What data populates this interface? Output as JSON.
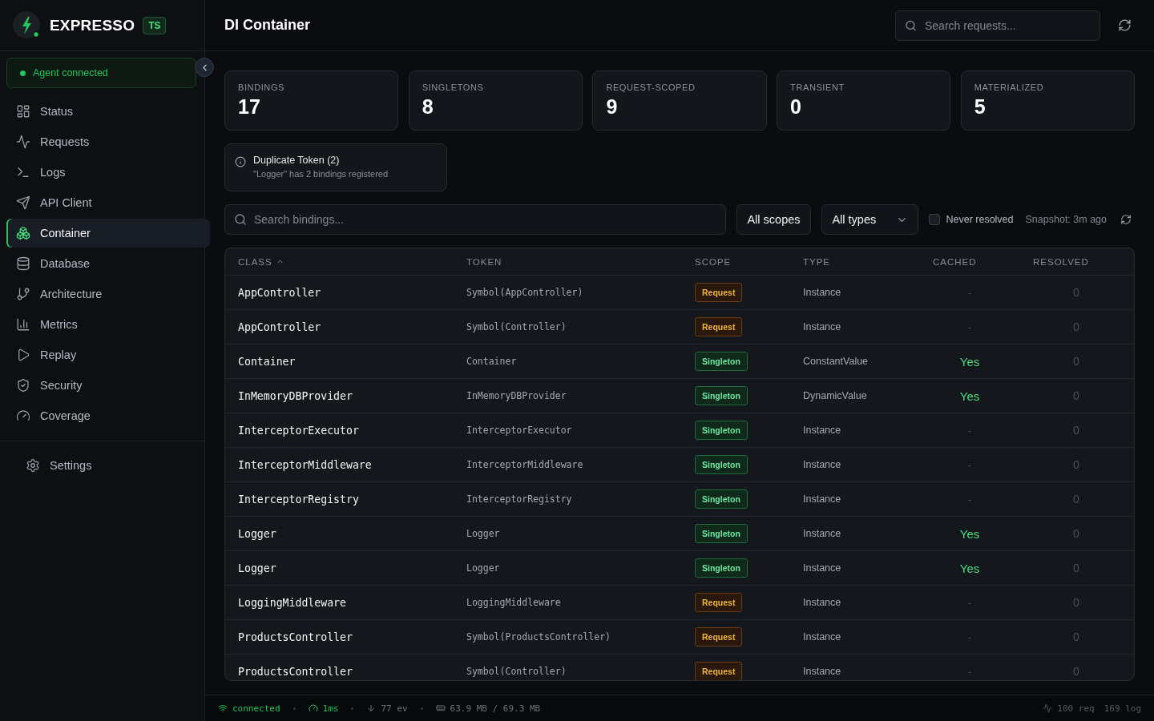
{
  "sidebar": {
    "brand": {
      "name": "EXPRESSO",
      "badge": "TS"
    },
    "agent_status": {
      "text": "Agent connected",
      "connected": true
    },
    "items": [
      {
        "label": "Status",
        "selected": false
      },
      {
        "label": "Requests",
        "selected": false
      },
      {
        "label": "Logs",
        "selected": false
      },
      {
        "label": "API Client",
        "selected": false
      },
      {
        "label": "Container",
        "selected": true
      },
      {
        "label": "Database",
        "selected": false
      },
      {
        "label": "Architecture",
        "selected": false
      },
      {
        "label": "Metrics",
        "selected": false
      },
      {
        "label": "Replay",
        "selected": false
      },
      {
        "label": "Security",
        "selected": false
      },
      {
        "label": "Coverage",
        "selected": false
      }
    ],
    "settings": {
      "label": "Settings"
    }
  },
  "header": {
    "title": "DI Container",
    "search": {
      "placeholder": "Search requests..."
    }
  },
  "stats": [
    {
      "label": "BINDINGS",
      "value": "17"
    },
    {
      "label": "SINGLETONS",
      "value": "8"
    },
    {
      "label": "REQUEST-SCOPED",
      "value": "9"
    },
    {
      "label": "TRANSIENT",
      "value": "0"
    },
    {
      "label": "MATERIALIZED",
      "value": "5"
    }
  ],
  "alerts": [
    {
      "title": "Duplicate Token (2)",
      "message": "\"Logger\" has 2 bindings registered"
    }
  ],
  "filters": {
    "search": {
      "placeholder": "Search bindings..."
    },
    "scope_select": {
      "value": "All scopes"
    },
    "type_select": {
      "value": "All types"
    },
    "never_resolved": {
      "label": "Never resolved",
      "checked": false
    },
    "snapshot": "Snapshot: 3m ago"
  },
  "table": {
    "columns": [
      {
        "label": "CLASS",
        "sorted": true
      },
      {
        "label": "TOKEN",
        "sorted": false
      },
      {
        "label": "SCOPE",
        "sorted": false
      },
      {
        "label": "TYPE",
        "sorted": false
      },
      {
        "label": "CACHED",
        "sorted": false
      },
      {
        "label": "RESOLVED",
        "sorted": false
      }
    ],
    "rows": [
      {
        "class": "AppController",
        "token": "Symbol(AppController)",
        "scope": {
          "label": "Request",
          "kind": "request"
        },
        "type": "Instance",
        "cached": "-",
        "is_cached": false,
        "resolved": "0"
      },
      {
        "class": "AppController",
        "token": "Symbol(Controller)",
        "scope": {
          "label": "Request",
          "kind": "request"
        },
        "type": "Instance",
        "cached": "-",
        "is_cached": false,
        "resolved": "0"
      },
      {
        "class": "Container",
        "token": "Container",
        "scope": {
          "label": "Singleton",
          "kind": "singleton"
        },
        "type": "ConstantValue",
        "cached": "Yes",
        "is_cached": true,
        "resolved": "0"
      },
      {
        "class": "InMemoryDBProvider",
        "token": "InMemoryDBProvider",
        "scope": {
          "label": "Singleton",
          "kind": "singleton"
        },
        "type": "DynamicValue",
        "cached": "Yes",
        "is_cached": true,
        "resolved": "0"
      },
      {
        "class": "InterceptorExecutor",
        "token": "InterceptorExecutor",
        "scope": {
          "label": "Singleton",
          "kind": "singleton"
        },
        "type": "Instance",
        "cached": "-",
        "is_cached": false,
        "resolved": "0"
      },
      {
        "class": "InterceptorMiddleware",
        "token": "InterceptorMiddleware",
        "scope": {
          "label": "Singleton",
          "kind": "singleton"
        },
        "type": "Instance",
        "cached": "-",
        "is_cached": false,
        "resolved": "0"
      },
      {
        "class": "InterceptorRegistry",
        "token": "InterceptorRegistry",
        "scope": {
          "label": "Singleton",
          "kind": "singleton"
        },
        "type": "Instance",
        "cached": "-",
        "is_cached": false,
        "resolved": "0"
      },
      {
        "class": "Logger",
        "token": "Logger",
        "scope": {
          "label": "Singleton",
          "kind": "singleton"
        },
        "type": "Instance",
        "cached": "Yes",
        "is_cached": true,
        "resolved": "0"
      },
      {
        "class": "Logger",
        "token": "Logger",
        "scope": {
          "label": "Singleton",
          "kind": "singleton"
        },
        "type": "Instance",
        "cached": "Yes",
        "is_cached": true,
        "resolved": "0"
      },
      {
        "class": "LoggingMiddleware",
        "token": "LoggingMiddleware",
        "scope": {
          "label": "Request",
          "kind": "request"
        },
        "type": "Instance",
        "cached": "-",
        "is_cached": false,
        "resolved": "0"
      },
      {
        "class": "ProductsController",
        "token": "Symbol(ProductsController)",
        "scope": {
          "label": "Request",
          "kind": "request"
        },
        "type": "Instance",
        "cached": "-",
        "is_cached": false,
        "resolved": "0"
      },
      {
        "class": "ProductsController",
        "token": "Symbol(Controller)",
        "scope": {
          "label": "Request",
          "kind": "request"
        },
        "type": "Instance",
        "cached": "-",
        "is_cached": false,
        "resolved": "0"
      }
    ]
  },
  "status_bar": {
    "left": [
      {
        "text": "connected",
        "kind": "connection"
      },
      {
        "text": "1ms",
        "kind": "latency"
      },
      {
        "text": "77 ev",
        "kind": "events"
      },
      {
        "text": "63.9 MB / 69.3 MB",
        "kind": "memory"
      }
    ],
    "right": [
      {
        "text": "100 req",
        "kind": "requests"
      },
      {
        "text": "169 log",
        "kind": "logs"
      }
    ]
  }
}
